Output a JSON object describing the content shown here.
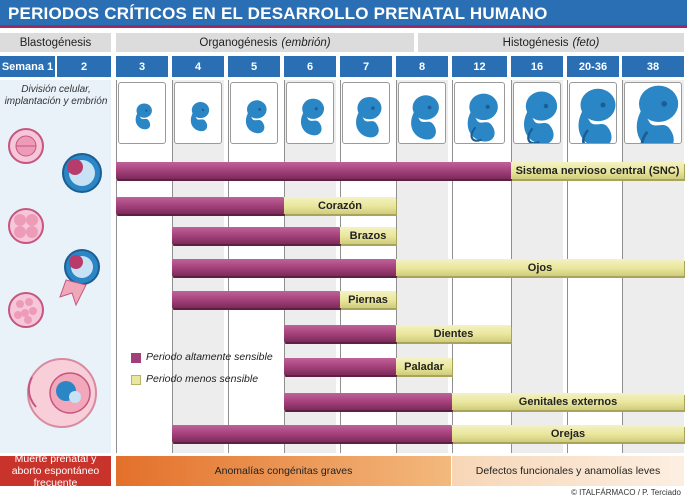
{
  "title": "PERIODOS CRÍTICOS EN EL DESARROLLO PRENATAL HUMANO",
  "phases": {
    "blasto": "Blastogénesis",
    "organo": "Organogénesis",
    "organo_note": "(embrión)",
    "histo": "Histogénesis",
    "histo_note": "(feto)"
  },
  "weeks": [
    "Semana 1",
    "2",
    "3",
    "4",
    "5",
    "6",
    "7",
    "8",
    "12",
    "16",
    "20-36",
    "38"
  ],
  "week1_caption": "División celular, implantación y embrión",
  "organs": [
    {
      "label": "Sistema nervioso central (SNC)",
      "high_from": "3",
      "high_to": "16",
      "low_from": "16",
      "low_to": "38"
    },
    {
      "label": "Corazón",
      "high_from": "3",
      "high_to": "6",
      "low_from": "6",
      "low_to": "8"
    },
    {
      "label": "Brazos",
      "high_from": "4",
      "high_to": "7",
      "low_from": "7",
      "low_to": "8"
    },
    {
      "label": "Ojos",
      "high_from": "4",
      "high_to": "8",
      "low_from": "8",
      "low_to": "38"
    },
    {
      "label": "Piernas",
      "high_from": "4",
      "high_to": "7",
      "low_from": "7",
      "low_to": "8"
    },
    {
      "label": "Dientes",
      "high_from": "6",
      "high_to": "8",
      "low_from": "8",
      "low_to": "16"
    },
    {
      "label": "Paladar",
      "high_from": "6",
      "high_to": "8",
      "low_from": "8",
      "low_to": "12"
    },
    {
      "label": "Genitales externos",
      "high_from": "6",
      "high_to": "12",
      "low_from": "12",
      "low_to": "38"
    },
    {
      "label": "Orejas",
      "high_from": "4",
      "high_to": "12",
      "low_from": "12",
      "low_to": "38"
    }
  ],
  "legend": {
    "high": "Periodo altamente sensible",
    "low": "Periodo menos sensible"
  },
  "footer": {
    "left": "Muerte prenatal y aborto espontáneo frecuente",
    "middle": "Anomalías congénitas graves",
    "right": "Defectos funcionales y anamolías leves"
  },
  "credit": "© ITALFÁRMACO / P. Terciado",
  "colors": {
    "title_bg": "#2a6fb4",
    "week_bg": "#2a6fb4",
    "high": "#a23f78",
    "low": "#e9e69d",
    "embryo": "#2b86c6"
  }
}
